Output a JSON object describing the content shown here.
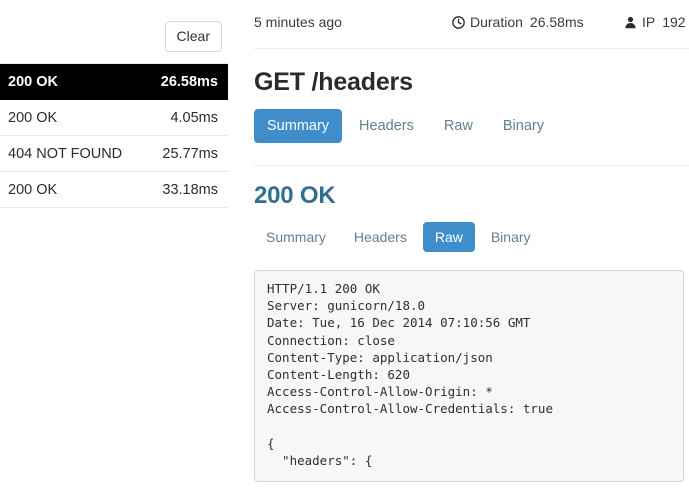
{
  "sidebar": {
    "clear_label": "Clear",
    "requests": [
      {
        "status": "200 OK",
        "duration": "26.58ms",
        "selected": true
      },
      {
        "status": "200 OK",
        "duration": "4.05ms",
        "selected": false
      },
      {
        "status": "404 NOT FOUND",
        "duration": "25.77ms",
        "selected": false
      },
      {
        "status": "200 OK",
        "duration": "33.18ms",
        "selected": false
      }
    ]
  },
  "meta": {
    "time_ago": "5 minutes ago",
    "clock_icon": "clock-icon",
    "duration_label": "Duration",
    "duration_value": "26.58ms",
    "person_icon": "person-icon",
    "ip_label": "IP",
    "ip_value": "192"
  },
  "request": {
    "title": "GET /headers",
    "tabs": [
      {
        "label": "Summary",
        "active": true
      },
      {
        "label": "Headers",
        "active": false
      },
      {
        "label": "Raw",
        "active": false
      },
      {
        "label": "Binary",
        "active": false
      }
    ]
  },
  "response": {
    "title": "200 OK",
    "tabs": [
      {
        "label": "Summary",
        "active": false
      },
      {
        "label": "Headers",
        "active": false
      },
      {
        "label": "Raw",
        "active": true
      },
      {
        "label": "Binary",
        "active": false
      }
    ],
    "raw_body": "HTTP/1.1 200 OK\nServer: gunicorn/18.0\nDate: Tue, 16 Dec 2014 07:10:56 GMT\nConnection: close\nContent-Type: application/json\nContent-Length: 620\nAccess-Control-Allow-Origin: *\nAccess-Control-Allow-Credentials: true\n\n{\n  \"headers\": {"
  },
  "colors": {
    "accent_blue": "#3f8dcb",
    "response_heading": "#31708f",
    "tab_link": "#63808f",
    "selected_row_bg": "#000000",
    "code_bg": "#f7f7f7"
  }
}
